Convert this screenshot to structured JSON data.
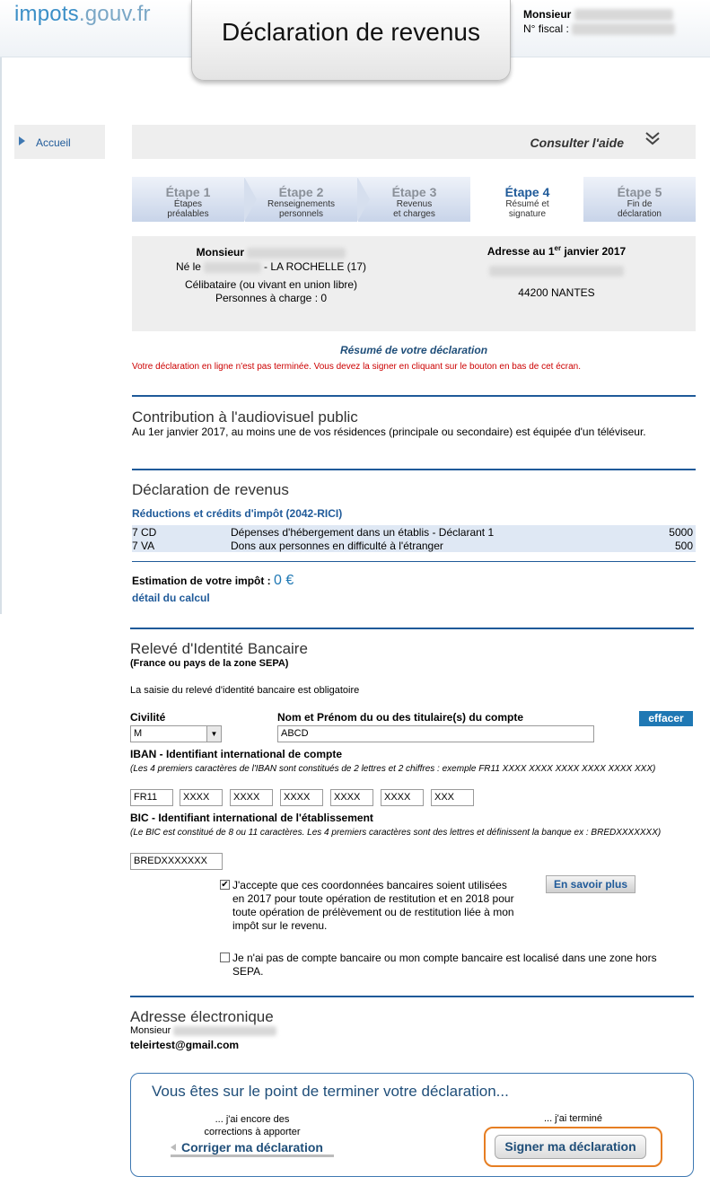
{
  "header": {
    "logo_main": "impots",
    "logo_suffix": ".gouv.fr",
    "title": "Déclaration de revenus",
    "user_title": "Monsieur",
    "fiscal_label": "N° fiscal :"
  },
  "sidebar": {
    "home": "Accueil"
  },
  "help": {
    "label": "Consulter l'aide",
    "chevron": "double-chevron-down-icon"
  },
  "steps": [
    {
      "title": "Étape 1",
      "sub1": "Étapes",
      "sub2": "préalables",
      "active": false
    },
    {
      "title": "Étape 2",
      "sub1": "Renseignements",
      "sub2": "personnels",
      "active": false
    },
    {
      "title": "Étape 3",
      "sub1": "Revenus",
      "sub2": "et charges",
      "active": false
    },
    {
      "title": "Étape 4",
      "sub1": "Résumé et",
      "sub2": "signature",
      "active": true
    },
    {
      "title": "Étape 5",
      "sub1": "Fin de",
      "sub2": "déclaration",
      "active": false
    }
  ],
  "identity": {
    "civility": "Monsieur",
    "born_prefix": "Né le",
    "born_place": "- LA ROCHELLE (17)",
    "status": "Célibataire (ou vivant en union libre)",
    "dependents": "Personnes à charge : 0",
    "address_title_a": "Adresse au 1",
    "address_title_sup": "er",
    "address_title_b": " janvier 2017",
    "address_city": "44200 NANTES"
  },
  "summary": {
    "title": "Résumé de votre déclaration",
    "warning": "Votre déclaration en ligne n'est pas terminée. Vous devez la signer en cliquant sur le bouton en bas de cet écran."
  },
  "audiovisual": {
    "title": "Contribution à l'audiovisuel public",
    "text": "Au 1er janvier 2017, au moins une de vos résidences (principale ou secondaire) est équipée d'un téléviseur."
  },
  "revenue": {
    "title": "Déclaration de revenus",
    "subtitle": "Réductions et crédits d'impôt (2042-RICI)",
    "rows": [
      {
        "code": "7 CD",
        "label": "Dépenses d'hébergement dans un établis - Déclarant 1",
        "amount": "5000"
      },
      {
        "code": "7 VA",
        "label": "Dons aux personnes en difficulté à l'étranger",
        "amount": "500"
      }
    ],
    "estimate_label": "Estimation de votre impôt :",
    "estimate_value": "0 €",
    "detail_link": "détail du calcul"
  },
  "rib": {
    "title": "Relevé d'Identité Bancaire",
    "subtitle": "(France ou pays de la zone SEPA)",
    "mandatory": "La saisie du relevé d'identité bancaire est obligatoire",
    "civility_label": "Civilité",
    "civility_value": "M",
    "holder_label": "Nom et Prénom du ou des titulaire(s) du compte",
    "holder_value": "ABCD",
    "clear_button": "effacer",
    "iban_label": "IBAN - Identifiant international de compte",
    "iban_note": "(Les 4 premiers caractères de l'IBAN sont constitués de 2 lettres et 2 chiffres : exemple FR11 XXXX XXXX XXXX XXXX XXXX XXX)",
    "iban_fields": [
      "FR11",
      "XXXX",
      "XXXX",
      "XXXX",
      "XXXX",
      "XXXX",
      "XXX"
    ],
    "bic_label": "BIC - Identifiant international de l'établissement",
    "bic_note": "(Le BIC est constitué de 8 ou 11 caractères. Les 4 premiers caractères sont des lettres et définissent la banque ex : BREDXXXXXXX)",
    "bic_value": "BREDXXXXXXX",
    "accept_checked": true,
    "accept_text": "J'accepte que ces coordonnées bancaires soient utilisées en 2017 pour toute opération de restitution et en 2018 pour toute opération de prélèvement ou de restitution liée à mon impôt sur le revenu.",
    "learn_more": "En savoir plus",
    "no_account_checked": false,
    "no_account_text": "Je n'ai pas de compte bancaire ou mon compte bancaire est localisé dans une zone hors SEPA."
  },
  "email": {
    "title": "Adresse électronique",
    "civility": "Monsieur",
    "address": "teleirtest@gmail.com"
  },
  "finish": {
    "title": "Vous êtes sur le point de terminer votre déclaration...",
    "left_note_1": "... j'ai encore des",
    "left_note_2": "corrections à apporter",
    "correct_button": "Corriger ma déclaration",
    "right_note": "... j'ai terminé",
    "sign_button": "Signer ma déclaration"
  }
}
